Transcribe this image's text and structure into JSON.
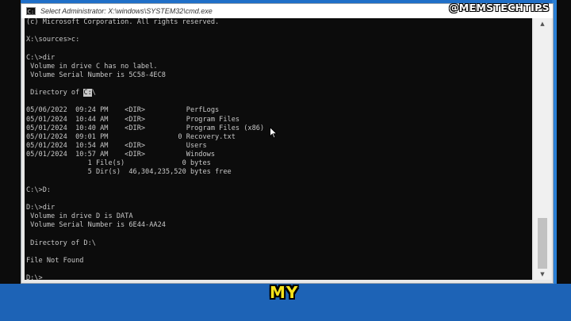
{
  "window": {
    "title": "Select Administrator: X:\\windows\\SYSTEM32\\cmd.exe",
    "icon": "cmd-icon"
  },
  "console": {
    "lines": [
      "(c) Microsoft Corporation. All rights reserved.",
      "",
      "X:\\sources>c:",
      "",
      "C:\\>dir",
      " Volume in drive C has no label.",
      " Volume Serial Number is 5C58-4EC8",
      "",
      " Directory of C:\\",
      "",
      "05/06/2022  09:24 PM    <DIR>          PerfLogs",
      "05/01/2024  10:44 AM    <DIR>          Program Files",
      "05/01/2024  10:40 AM    <DIR>          Program Files (x86)",
      "05/01/2024  09:01 PM                 0 Recovery.txt",
      "05/01/2024  10:54 AM    <DIR>          Users",
      "05/01/2024  10:57 AM    <DIR>          Windows",
      "               1 File(s)              0 bytes",
      "               5 Dir(s)  46,304,235,520 bytes free",
      "",
      "C:\\>D:",
      "",
      "D:\\>dir",
      " Volume in drive D is DATA",
      " Volume Serial Number is 6E44-AA24",
      "",
      " Directory of D:\\",
      "",
      "File Not Found",
      "",
      "D:\\>"
    ],
    "directory_of_prefix": " Directory of ",
    "directory_of_selected": "C:",
    "directory_of_suffix": "\\",
    "text_color": "#c8c8c8",
    "background_color": "#0c0c0c"
  },
  "overlay": {
    "watermark": "@MEMSTECHTIPS",
    "caption": "MY",
    "caption_color": "#f5e21a"
  },
  "icons": {
    "scroll_up": "▲",
    "scroll_down": "▼",
    "pointer": "mouse-pointer-icon"
  }
}
